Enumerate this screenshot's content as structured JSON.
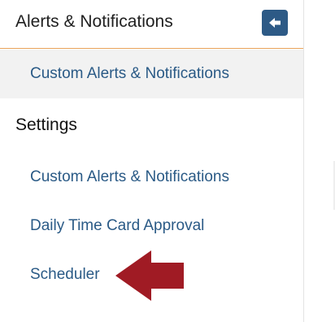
{
  "header": {
    "title": "Alerts & Notifications",
    "collapse_icon": "arrow-left-icon",
    "accent_color": "#2d5a86",
    "divider_color": "#e8a25a"
  },
  "active_item": {
    "label": "Custom Alerts & Notifications"
  },
  "settings": {
    "heading": "Settings",
    "items": [
      {
        "label": "Custom Alerts & Notifications"
      },
      {
        "label": "Daily Time Card Approval"
      },
      {
        "label": "Scheduler"
      }
    ]
  },
  "annotation": {
    "icon": "red-arrow-icon",
    "color": "#a01b24",
    "points_to": "Scheduler"
  }
}
